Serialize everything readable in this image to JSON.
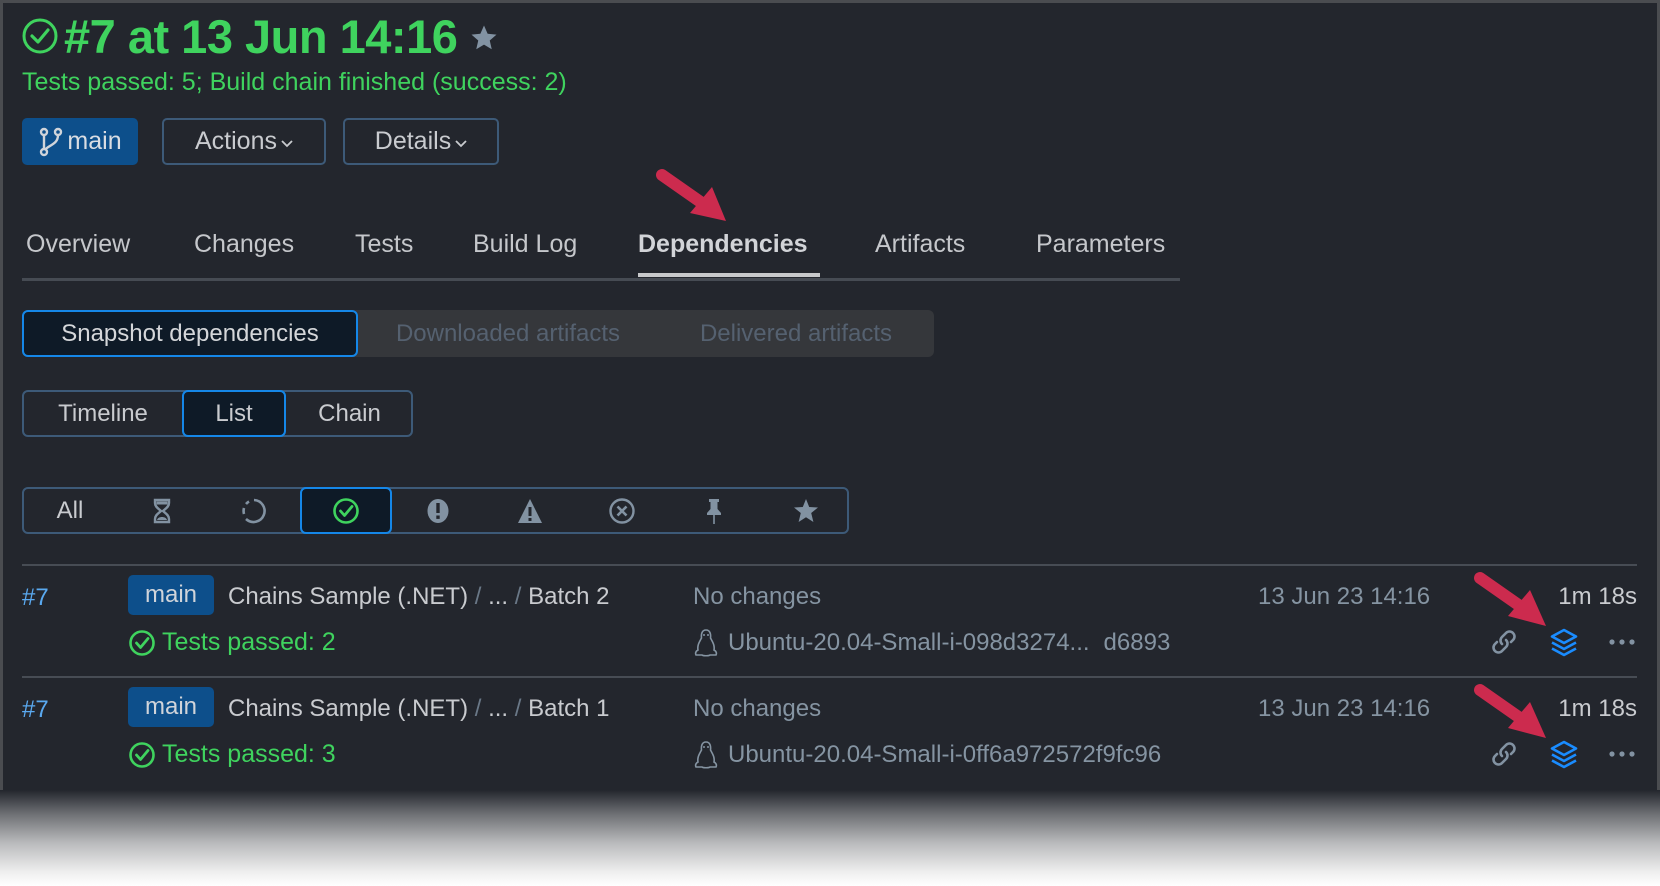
{
  "header": {
    "title": "#7 at 13 Jun 14:16",
    "status_icon": "check-circle-icon",
    "favorite_icon": "star-icon",
    "subtitle": "Tests passed: 5; Build chain finished (success: 2)"
  },
  "toolbar": {
    "branch_label": "main",
    "branch_icon": "git-branch-icon",
    "actions_label": "Actions",
    "details_label": "Details"
  },
  "tabs": [
    {
      "label": "Overview",
      "active": false
    },
    {
      "label": "Changes",
      "active": false
    },
    {
      "label": "Tests",
      "active": false
    },
    {
      "label": "Build Log",
      "active": false
    },
    {
      "label": "Dependencies",
      "active": true
    },
    {
      "label": "Artifacts",
      "active": false
    },
    {
      "label": "Parameters",
      "active": false
    }
  ],
  "dependency_type": {
    "options": [
      "Snapshot dependencies",
      "Downloaded artifacts",
      "Delivered artifacts"
    ],
    "selected": "Snapshot dependencies"
  },
  "view_mode": {
    "options": [
      "Timeline",
      "List",
      "Chain"
    ],
    "selected": "List"
  },
  "status_filter": {
    "all_label": "All",
    "options": [
      "all",
      "queued-hourglass-icon",
      "running-icon",
      "success-check-icon",
      "failed-exclamation-icon",
      "warning-icon",
      "canceled-x-icon",
      "pinned-icon",
      "starred-icon"
    ],
    "selected": "success-check-icon"
  },
  "builds": [
    {
      "number": "#7",
      "branch": "main",
      "name_parts": [
        "Chains Sample (.NET)",
        "...",
        "Batch 2"
      ],
      "status": "Tests passed: 2",
      "changes": "No changes",
      "agent": "Ubuntu-20.04-Small-i-098d3274...",
      "revision": "d6893",
      "date": "13 Jun 23 14:16",
      "duration": "1m 18s"
    },
    {
      "number": "#7",
      "branch": "main",
      "name_parts": [
        "Chains Sample (.NET)",
        "...",
        "Batch 1"
      ],
      "status": "Tests passed: 3",
      "changes": "No changes",
      "agent": "Ubuntu-20.04-Small-i-0ff6a972572f9fc96",
      "revision": "",
      "date": "13 Jun 23 14:16",
      "duration": "1m 18s"
    }
  ],
  "annotations": {
    "arrow_color": "#cc2b4e"
  },
  "colors": {
    "success": "#3fd35e",
    "accent": "#1587e8",
    "branch_bg": "#0d4f8b",
    "link": "#5aa9f0"
  }
}
